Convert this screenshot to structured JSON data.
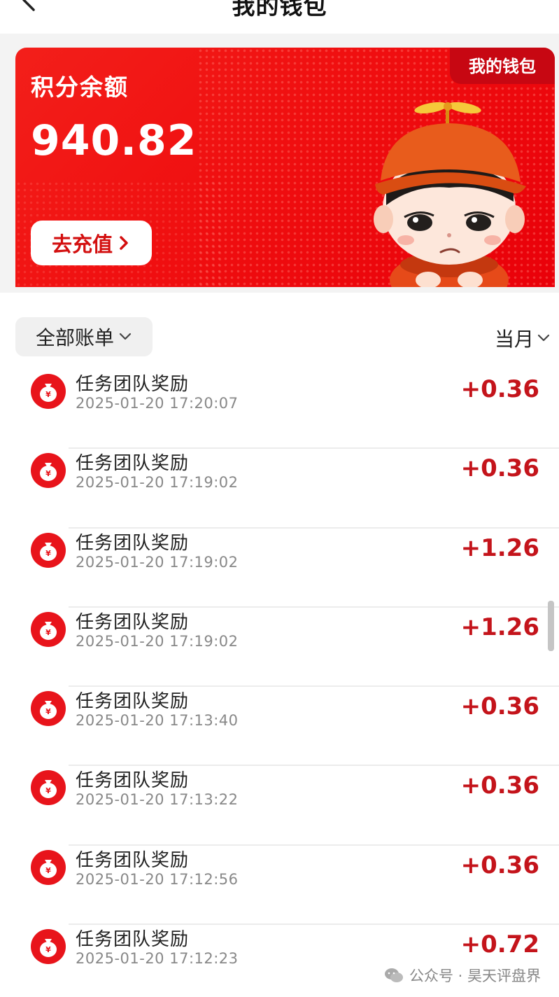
{
  "header": {
    "title": "我的钱包",
    "back_icon": "back-arrow-icon"
  },
  "card": {
    "tag": "我的钱包",
    "balance_label": "积分余额",
    "balance_value": "940.82",
    "recharge_label": "去充值",
    "accent_color": "#f00f10"
  },
  "filters": {
    "all_label": "全部账单",
    "month_label": "当月"
  },
  "transactions": [
    {
      "title": "任务团队奖励",
      "time": "2025-01-20 17:20:07",
      "amount": "+0.36"
    },
    {
      "title": "任务团队奖励",
      "time": "2025-01-20 17:19:02",
      "amount": "+0.36"
    },
    {
      "title": "任务团队奖励",
      "time": "2025-01-20 17:19:02",
      "amount": "+1.26"
    },
    {
      "title": "任务团队奖励",
      "time": "2025-01-20 17:19:02",
      "amount": "+1.26"
    },
    {
      "title": "任务团队奖励",
      "time": "2025-01-20 17:13:40",
      "amount": "+0.36"
    },
    {
      "title": "任务团队奖励",
      "time": "2025-01-20 17:13:22",
      "amount": "+0.36"
    },
    {
      "title": "任务团队奖励",
      "time": "2025-01-20 17:12:56",
      "amount": "+0.36"
    },
    {
      "title": "任务团队奖励",
      "time": "2025-01-20 17:12:23",
      "amount": "+0.72"
    }
  ],
  "watermark": {
    "text": "公众号 · 昊天评盘界",
    "icon": "wechat-icon"
  }
}
